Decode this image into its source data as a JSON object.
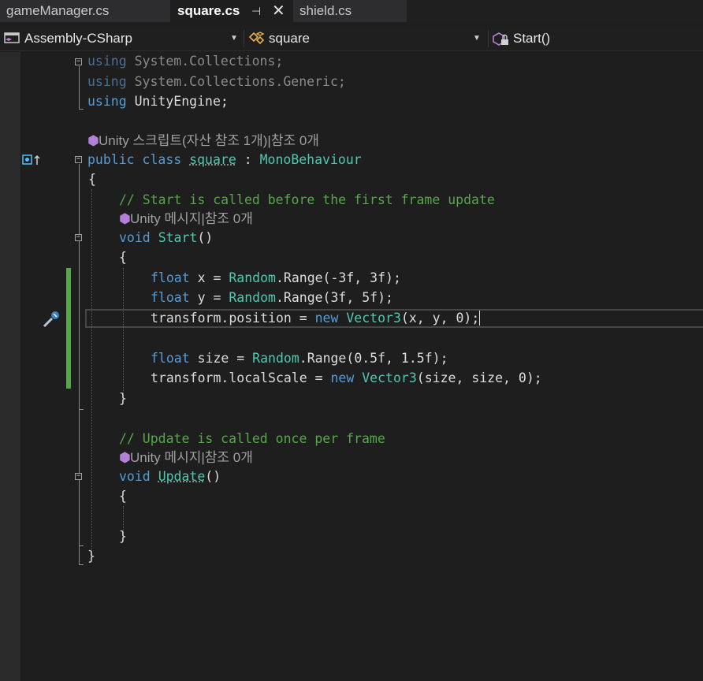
{
  "tabs": [
    {
      "label": "gameManager.cs",
      "active": false
    },
    {
      "label": "square.cs",
      "active": true,
      "pin_icon": "pin-icon",
      "close_icon": "close-icon"
    },
    {
      "label": "shield.cs",
      "active": false
    }
  ],
  "navbar": {
    "project": "Assembly-CSharp",
    "type": "square",
    "member": "Start()"
  },
  "codelens": {
    "class_refs": "Unity 스크립트(자산 참조 1개)|참조 0개",
    "start_refs": "Unity 메시지|참조 0개",
    "update_refs": "Unity 메시지|참조 0개"
  },
  "code": {
    "using1_kw": "using",
    "using1_ns": "System.Collections;",
    "using2_kw": "using",
    "using2_ns": "System.Collections.Generic;",
    "using3_kw": "using",
    "using3_ns": "UnityEngine;",
    "class_public": "public",
    "class_class": "class",
    "class_name": "square",
    "class_colon": " : ",
    "class_base": "MonoBehaviour",
    "brace_open_class": "{",
    "comment_start": "// Start is called before the first frame update",
    "start_void": "void",
    "start_name": "Start",
    "start_parens": "()",
    "brace_open_start": "{",
    "x_float": "float",
    "x_rest1": " x = ",
    "x_random": "Random",
    "x_range": ".Range(",
    "x_args": "-3f, 3f",
    "x_end": ");",
    "y_float": "float",
    "y_rest1": " y = ",
    "y_random": "Random",
    "y_range": ".Range(",
    "y_args": "3f, 5f",
    "y_end": ");",
    "pos_a": "transform.position = ",
    "pos_new": "new",
    "pos_type": "Vector3",
    "pos_args": "(x, y, 0);",
    "size_float": "float",
    "size_rest1": " size = ",
    "size_random": "Random",
    "size_range": ".Range(",
    "size_args": "0.5f, 1.5f",
    "size_end": ");",
    "scale_a": "transform.localScale = ",
    "scale_new": "new",
    "scale_type": "Vector3",
    "scale_args": "(size, size, 0);",
    "brace_close_start": "}",
    "comment_update": "// Update is called once per frame",
    "update_void": "void",
    "update_name": "Update",
    "update_parens": "()",
    "brace_open_update": "{",
    "brace_close_update": "}",
    "brace_close_class": "}"
  },
  "colors": {
    "keyword": "#569cd6",
    "type": "#4ec9b0",
    "comment": "#57a64a",
    "change_bar": "#57a64a"
  }
}
